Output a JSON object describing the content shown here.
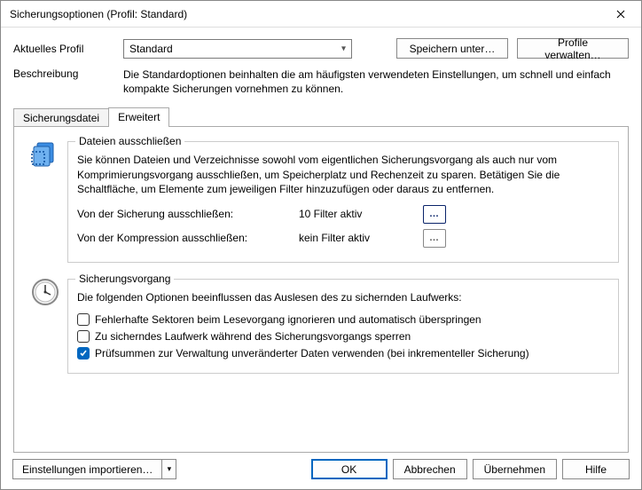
{
  "window": {
    "title": "Sicherungsoptionen (Profil: Standard)"
  },
  "top": {
    "profile_label": "Aktuelles Profil",
    "profile_value": "Standard",
    "save_as": "Speichern unter…",
    "manage": "Profile verwalten…",
    "desc_label": "Beschreibung",
    "desc_text": "Die Standardoptionen beinhalten die am häufigsten verwendeten Einstellungen, um schnell und einfach kompakte Sicherungen vornehmen zu können."
  },
  "tabs": {
    "t1": "Sicherungsdatei",
    "t2": "Erweitert"
  },
  "exclude": {
    "legend": "Dateien ausschließen",
    "intro": "Sie können Dateien und Verzeichnisse sowohl vom eigentlichen Sicherungsvorgang als auch nur vom Komprimierungsvorgang ausschließen, um Speicherplatz und Rechenzeit zu sparen. Betätigen Sie die Schaltfläche, um Elemente zum jeweiligen Filter hinzuzufügen oder daraus zu entfernen.",
    "row1_label": "Von der Sicherung ausschließen:",
    "row1_status": "10 Filter aktiv",
    "row2_label": "Von der Kompression ausschließen:",
    "row2_status": "kein Filter aktiv",
    "ellipsis": "…"
  },
  "process": {
    "legend": "Sicherungsvorgang",
    "intro": "Die folgenden Optionen beeinflussen das Auslesen des zu sichernden Laufwerks:",
    "chk1": "Fehlerhafte Sektoren beim Lesevorgang ignorieren und automatisch überspringen",
    "chk2": "Zu sicherndes Laufwerk während des Sicherungsvorgangs sperren",
    "chk3": "Prüfsummen zur Verwaltung unveränderter Daten verwenden (bei inkrementeller Sicherung)"
  },
  "footer": {
    "import": "Einstellungen importieren…",
    "ok": "OK",
    "cancel": "Abbrechen",
    "apply": "Übernehmen",
    "help": "Hilfe"
  }
}
